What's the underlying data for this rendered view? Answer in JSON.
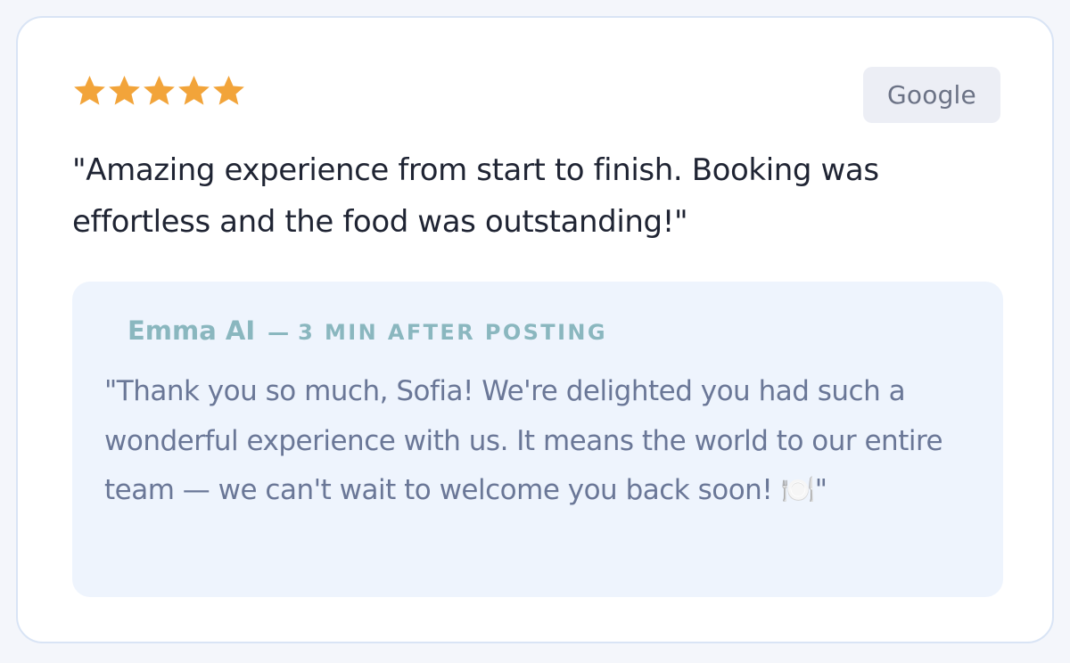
{
  "review": {
    "rating": 5,
    "rating_max": 5,
    "star_color": "#f2a43a",
    "source": "Google",
    "text": "\"Amazing experience from start to finish. Booking was effortless and the food was outstanding!\""
  },
  "reply": {
    "author": "Emma AI",
    "separator": "—",
    "meta": "3 MIN AFTER POSTING",
    "text": "\"Thank you so much, Sofia! We're delighted you had such a wonderful experience with us. It means the world to our entire team — we can't wait to welcome you back soon! 🍽️\""
  },
  "colors": {
    "accent": "#8ab7bf",
    "reply_background": "#eef4fd",
    "card_border": "#d9e4f5"
  }
}
